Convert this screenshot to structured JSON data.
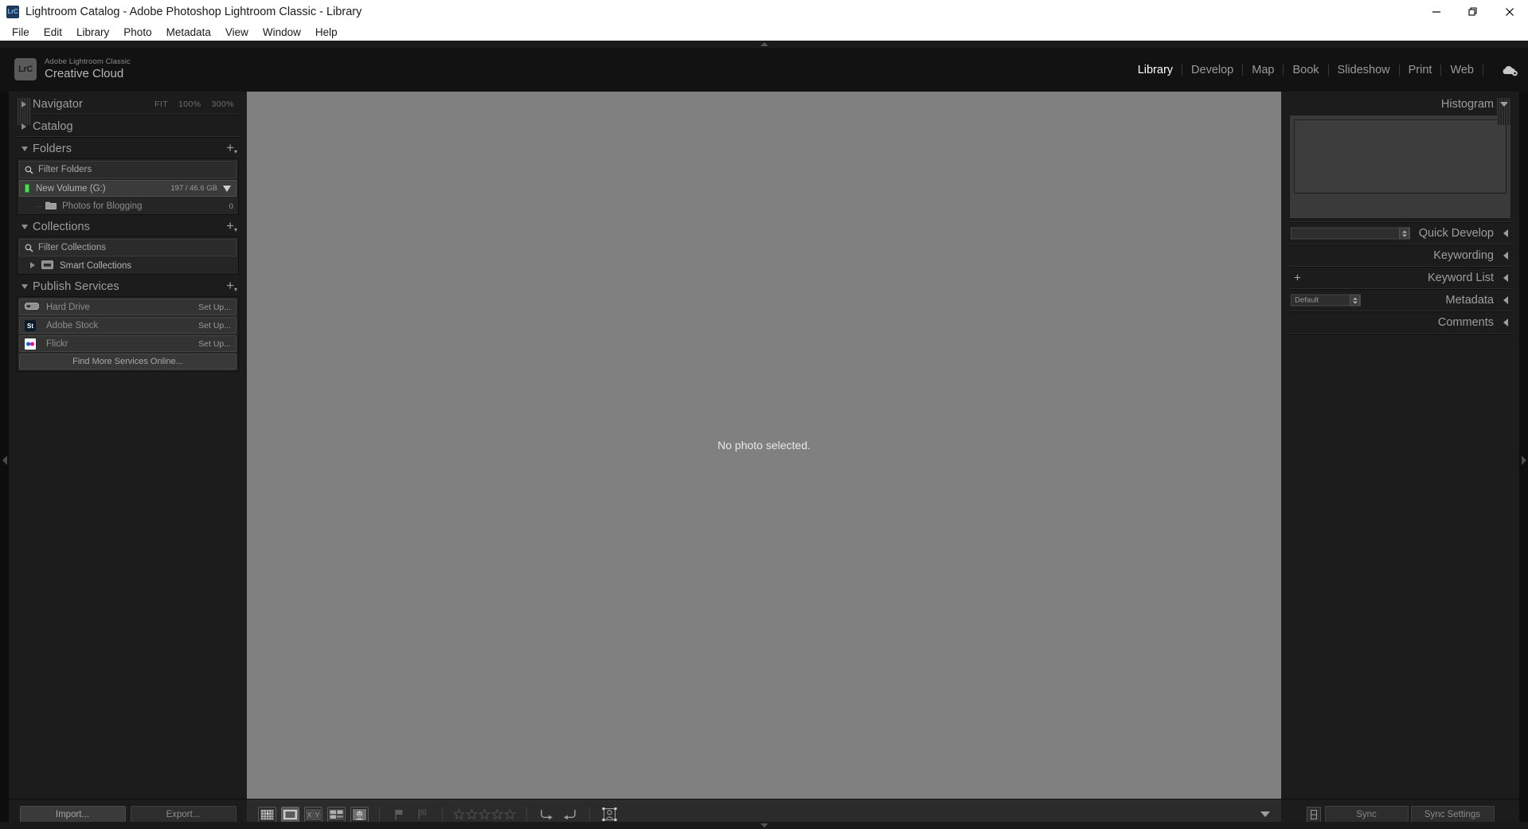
{
  "window": {
    "title": "Lightroom Catalog - Adobe Photoshop Lightroom Classic - Library",
    "app_icon": "LrC",
    "controls": {
      "minimize": "minimize-icon",
      "restore": "restore-icon",
      "close": "close-icon"
    }
  },
  "menubar": {
    "items": [
      "File",
      "Edit",
      "Library",
      "Photo",
      "Metadata",
      "View",
      "Window",
      "Help"
    ]
  },
  "identity": {
    "badge": "LrC",
    "line1": "Adobe Lightroom Classic",
    "line2": "Creative Cloud"
  },
  "modules": {
    "items": [
      "Library",
      "Develop",
      "Map",
      "Book",
      "Slideshow",
      "Print",
      "Web"
    ],
    "active": "Library"
  },
  "left_panel": {
    "navigator": {
      "title": "Navigator",
      "expanded": false,
      "zoom_levels": [
        "FIT",
        "100%",
        "300%"
      ]
    },
    "catalog": {
      "title": "Catalog",
      "expanded": false
    },
    "folders": {
      "title": "Folders",
      "expanded": true,
      "filter_placeholder": "Filter Folders",
      "volume": {
        "name": "New Volume (G:)",
        "space": "197 / 46.6 GB",
        "selected": true
      },
      "items": [
        {
          "name": "Photos for Blogging",
          "count": "0"
        }
      ]
    },
    "collections": {
      "title": "Collections",
      "expanded": true,
      "filter_placeholder": "Filter Collections",
      "items": [
        {
          "name": "Smart Collections"
        }
      ]
    },
    "publish_services": {
      "title": "Publish Services",
      "expanded": true,
      "services": [
        {
          "name": "Hard Drive",
          "action": "Set Up...",
          "icon": "hard-drive-icon"
        },
        {
          "name": "Adobe Stock",
          "action": "Set Up...",
          "icon": "adobe-stock-icon"
        },
        {
          "name": "Flickr",
          "action": "Set Up...",
          "icon": "flickr-icon"
        }
      ],
      "find_more": "Find More Services Online..."
    },
    "buttons": {
      "import": "Import...",
      "export": "Export..."
    }
  },
  "canvas": {
    "message": "No photo selected."
  },
  "toolbar": {
    "view_modes": [
      {
        "name": "grid-view-icon",
        "active": false
      },
      {
        "name": "loupe-view-icon",
        "active": true
      },
      {
        "name": "compare-view-icon",
        "active": false
      },
      {
        "name": "survey-view-icon",
        "active": false
      },
      {
        "name": "people-view-icon",
        "active": false
      }
    ],
    "flags": [
      "flag-pick-icon",
      "flag-reject-icon"
    ],
    "rating_stars": 5,
    "rating_filled": 0,
    "rotate": [
      "rotate-right-icon",
      "rotate-left-icon"
    ],
    "crop": "crop-overlay-icon",
    "dropdown": "toolbar-dropdown-icon"
  },
  "right_panel": {
    "histogram": {
      "title": "Histogram",
      "expanded": true
    },
    "sections": [
      {
        "title": "Quick Develop",
        "expanded": false,
        "control": "blank-select"
      },
      {
        "title": "Keywording",
        "expanded": false,
        "control": "none"
      },
      {
        "title": "Keyword List",
        "expanded": false,
        "control": "plus"
      },
      {
        "title": "Metadata",
        "expanded": false,
        "control": "select",
        "select_value": "Default"
      },
      {
        "title": "Comments",
        "expanded": false,
        "control": "none"
      }
    ],
    "buttons": {
      "sync": "Sync",
      "sync_settings": "Sync Settings"
    }
  },
  "colors": {
    "panel_bg": "#1c1c1c",
    "canvas_bg": "#808080",
    "accent_active": "#ffffff",
    "volume_led": "#4fdc4f"
  }
}
